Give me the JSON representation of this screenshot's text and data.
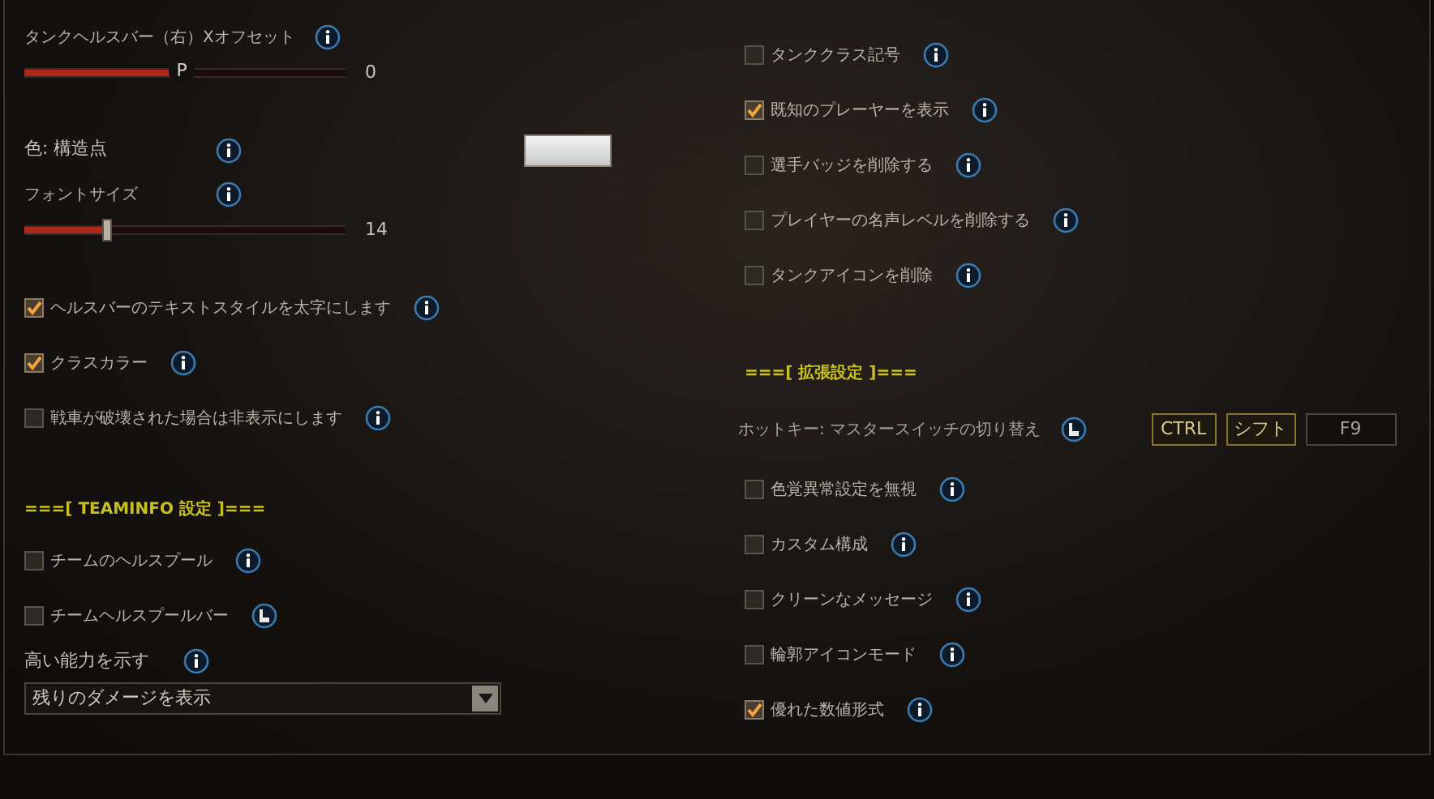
{
  "left": [
    {
      "kind": "label",
      "text": "タンクヘルスバー（右）Xオフセット"
    },
    {
      "kind": "slider",
      "level": 0.49,
      "thumb": "P",
      "value": "0"
    },
    {
      "kind": "color",
      "text": "色: 構造点"
    },
    {
      "kind": "label",
      "text": "フォントサイズ"
    },
    {
      "kind": "slider",
      "level": 0.26,
      "value": "14"
    },
    {
      "kind": "checkbox",
      "text": "ヘルスバーのテキストスタイルを太字にします",
      "checked": true
    },
    {
      "kind": "checkbox",
      "text": "クラスカラー",
      "checked": true
    },
    {
      "kind": "checkbox",
      "text": "戦車が破壊された場合は非表示にします",
      "checked": false
    },
    {
      "kind": "header",
      "text": "===[ TEAMINFO 設定 ]==="
    },
    {
      "kind": "checkbox",
      "text": "チームのヘルスプール",
      "checked": false
    },
    {
      "kind": "checkbox",
      "text": "チームヘルスプールバー",
      "checked": false
    },
    {
      "kind": "label",
      "text": "高い能力を示す"
    },
    {
      "kind": "dropdown",
      "value": "残りのダメージを表示"
    }
  ],
  "right": [
    {
      "kind": "checkbox",
      "text": "タンククラス記号",
      "checked": false
    },
    {
      "kind": "checkbox",
      "text": "既知のプレーヤーを表示",
      "checked": true
    },
    {
      "kind": "checkbox",
      "text": "選手バッジを削除する",
      "checked": false
    },
    {
      "kind": "checkbox",
      "text": "プレイヤーの名声レベルを削除する",
      "checked": false
    },
    {
      "kind": "checkbox",
      "text": "タンクアイコンを削除",
      "checked": false
    },
    {
      "kind": "header",
      "text": "===[ 拡張設定 ]==="
    },
    {
      "kind": "hotkey",
      "text": "ホットキー: マスタースイッチの切り替え",
      "keys": [
        {
          "label": "CTRL",
          "on": true
        },
        {
          "label": "シフト",
          "on": true
        },
        {
          "label": "F9",
          "on": false
        }
      ]
    },
    {
      "kind": "checkbox",
      "text": "色覚異常設定を無視",
      "checked": false
    },
    {
      "kind": "checkbox",
      "text": "カスタム構成",
      "checked": false
    },
    {
      "kind": "checkbox",
      "text": "クリーンなメッセージ",
      "checked": false
    },
    {
      "kind": "checkbox",
      "text": "輪郭アイコンモード",
      "checked": false
    },
    {
      "kind": "checkbox",
      "text": "優れた数値形式",
      "checked": true
    }
  ]
}
